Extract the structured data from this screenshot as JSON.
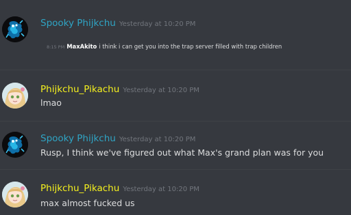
{
  "colors": {
    "spooky": "#2fa4c4",
    "pika": "#f5f01e",
    "background": "#36393f",
    "timestamp": "#72767d"
  },
  "messages": [
    {
      "author": "Spooky Phijkchu",
      "timestamp": "Yesterday at 10:20 PM",
      "avatar_icon": "blue-frog-avatar-icon",
      "quote": {
        "time": "8:15 PM",
        "author": "MaxAkito",
        "text": "i think i can get you into the trap server filled with trap children"
      }
    },
    {
      "author": "Phijkchu_Pikachu",
      "timestamp": "Yesterday at 10:20 PM",
      "avatar_icon": "anime-girl-avatar-icon",
      "text": "lmao"
    },
    {
      "author": "Spooky Phijkchu",
      "timestamp": "Yesterday at 10:20 PM",
      "avatar_icon": "blue-frog-avatar-icon",
      "text": "Rusp, I think we've figured out what Max's grand plan was for you"
    },
    {
      "author": "Phijkchu_Pikachu",
      "timestamp": "Yesterday at 10:20 PM",
      "avatar_icon": "anime-girl-avatar-icon",
      "text": "max almost fucked us"
    }
  ]
}
